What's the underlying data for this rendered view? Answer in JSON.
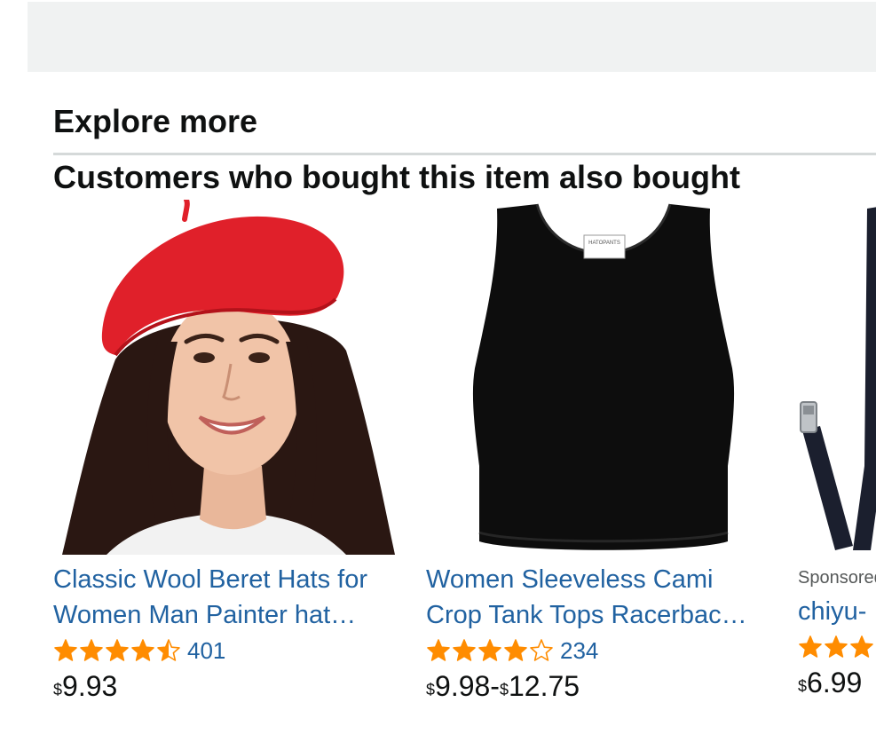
{
  "header": {
    "explore_title": "Explore more",
    "section_title": "Customers who bought this item also bought"
  },
  "colors": {
    "link": "#2162a1",
    "star": "#ff8c00",
    "text": "#0f1111",
    "muted": "#565959",
    "topbar": "#f0f2f2"
  },
  "products": [
    {
      "title_line1": "Classic Wool Beret Hats for",
      "title_line2": "Women Man Painter hat…",
      "rating": 4.5,
      "reviews": "401",
      "currency": "$",
      "price": "9.93",
      "image_icon": "red-beret-photo"
    },
    {
      "title_line1": "Women Sleeveless Cami",
      "title_line2": "Crop Tank Tops Racerbac…",
      "rating": 4.0,
      "reviews": "234",
      "currency": "$",
      "price_low": "9.98",
      "price_sep": "-",
      "price_high": "12.75",
      "image_icon": "black-tank-top-photo",
      "tag_text": "HATOPANTS"
    },
    {
      "sponsored": "Sponsored",
      "title_line1": "chiyu-",
      "rating": 3.0,
      "currency": "$",
      "price": "6.99",
      "image_icon": "suspenders-photo"
    }
  ]
}
